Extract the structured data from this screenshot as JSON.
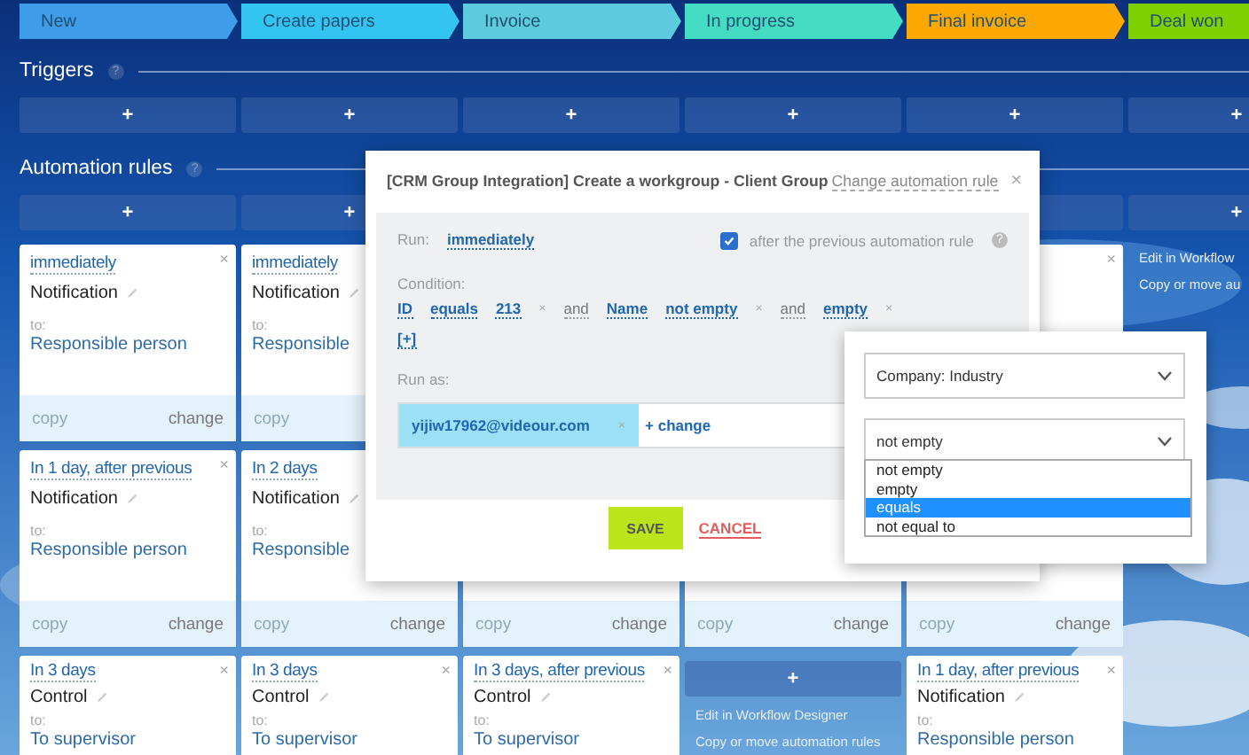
{
  "stages": [
    {
      "label": "New",
      "color": "#3e9ce8"
    },
    {
      "label": "Create papers",
      "color": "#33c4f2"
    },
    {
      "label": "Invoice",
      "color": "#5ccbdd"
    },
    {
      "label": "In progress",
      "color": "#44dcc2"
    },
    {
      "label": "Final invoice",
      "color": "#fca800"
    },
    {
      "label": "Deal won",
      "color": "#7fd000"
    }
  ],
  "triggers": {
    "title": "Triggers",
    "help": "?",
    "add_buttons": [
      {
        "kind": "plus",
        "label": "+"
      },
      {
        "kind": "plus",
        "label": "+"
      },
      {
        "kind": "plus",
        "label": "+"
      },
      {
        "kind": "plus",
        "label": "+"
      },
      {
        "kind": "plus",
        "label": "+"
      },
      {
        "kind": "plus",
        "label": "+"
      }
    ]
  },
  "automation_rules": {
    "title": "Automation rules",
    "help": "?",
    "add_buttons": [
      {
        "kind": "plus",
        "label": "+"
      },
      {
        "kind": "plus",
        "label": "+"
      },
      {
        "kind": "covered"
      },
      {
        "kind": "covered"
      },
      {
        "kind": "blank"
      },
      {
        "kind": "plus",
        "label": "+"
      }
    ]
  },
  "rule_rows": [
    [
      {
        "kind": "card",
        "timing": "immediately",
        "close": "×",
        "type": "Notification",
        "to_label": "to:",
        "recipient": "Responsible person",
        "copy": "copy",
        "change": "change"
      },
      {
        "kind": "card",
        "timing": "immediately",
        "type": "Notification",
        "to_label": "to:",
        "recipient": "Responsible",
        "copy": "copy"
      },
      {
        "kind": "covered"
      },
      {
        "kind": "covered"
      },
      {
        "kind": "card",
        "close": "×"
      },
      {
        "kind": "empty",
        "links": [
          "Edit in Workflow",
          "Copy or move au"
        ]
      }
    ],
    [
      {
        "kind": "card",
        "timing": "In 1 day, after previous",
        "close": "×",
        "type": "Notification",
        "to_label": "to:",
        "recipient": "Responsible person",
        "copy": "copy",
        "change": "change"
      },
      {
        "kind": "card",
        "timing": "In 2 days",
        "type": "Notification",
        "to_label": "to:",
        "recipient": "Responsible",
        "copy": "copy",
        "change": "change"
      },
      {
        "kind": "card",
        "copy": "copy",
        "change": "change"
      },
      {
        "kind": "card",
        "copy": "copy",
        "change": "change"
      },
      {
        "kind": "card",
        "copy": "copy",
        "change": "change"
      }
    ],
    [
      {
        "kind": "card",
        "timing": "In 3 days",
        "close": "×",
        "type": "Control",
        "to_label": "to:",
        "recipient": "To supervisor"
      },
      {
        "kind": "card",
        "timing": "In 3 days",
        "close": "×",
        "type": "Control",
        "to_label": "to:",
        "recipient": "To supervisor"
      },
      {
        "kind": "card",
        "timing": "In 3 days, after previous",
        "close": "×",
        "type": "Control",
        "to_label": "to:",
        "recipient": "To supervisor"
      },
      {
        "kind": "empty",
        "add": "+",
        "links": [
          "Edit in Workflow Designer",
          "Copy or move automation rules"
        ]
      },
      {
        "kind": "card",
        "timing": "In 1 day, after previous",
        "close": "×",
        "type": "Notification",
        "to_label": "to:",
        "recipient": "Responsible person"
      }
    ]
  ],
  "modal": {
    "title": "[CRM Group Integration] Create a workgroup - Client Group",
    "subtitle": "Change automation rule",
    "close": "×",
    "run_label": "Run:",
    "run_value": "immediately",
    "after_previous": {
      "label": "after the previous automation rule",
      "checked": true
    },
    "help": "?",
    "condition_label": "Condition:",
    "condition": [
      {
        "kind": "link",
        "text": "ID"
      },
      {
        "kind": "link",
        "text": "equals"
      },
      {
        "kind": "link",
        "text": "213"
      },
      {
        "kind": "remove",
        "text": "×"
      },
      {
        "kind": "join",
        "text": "and"
      },
      {
        "kind": "link",
        "text": "Name"
      },
      {
        "kind": "link",
        "text": "not empty"
      },
      {
        "kind": "remove",
        "text": "×"
      },
      {
        "kind": "join",
        "text": "and"
      },
      {
        "kind": "link",
        "text": "empty"
      },
      {
        "kind": "remove",
        "text": "×"
      }
    ],
    "add_condition": "[+]",
    "run_as_label": "Run as:",
    "run_as": {
      "user": "yijiw17962@videour.com",
      "remove": "×",
      "change": "+ change"
    },
    "save": "SAVE",
    "cancel": "CANCEL"
  },
  "popup": {
    "field_select": "Company: Industry",
    "operator_select": "not empty",
    "options": [
      {
        "label": "not empty",
        "selected": false
      },
      {
        "label": "empty",
        "selected": false
      },
      {
        "label": "equals",
        "selected": true
      },
      {
        "label": "not equal to",
        "selected": false
      }
    ]
  }
}
